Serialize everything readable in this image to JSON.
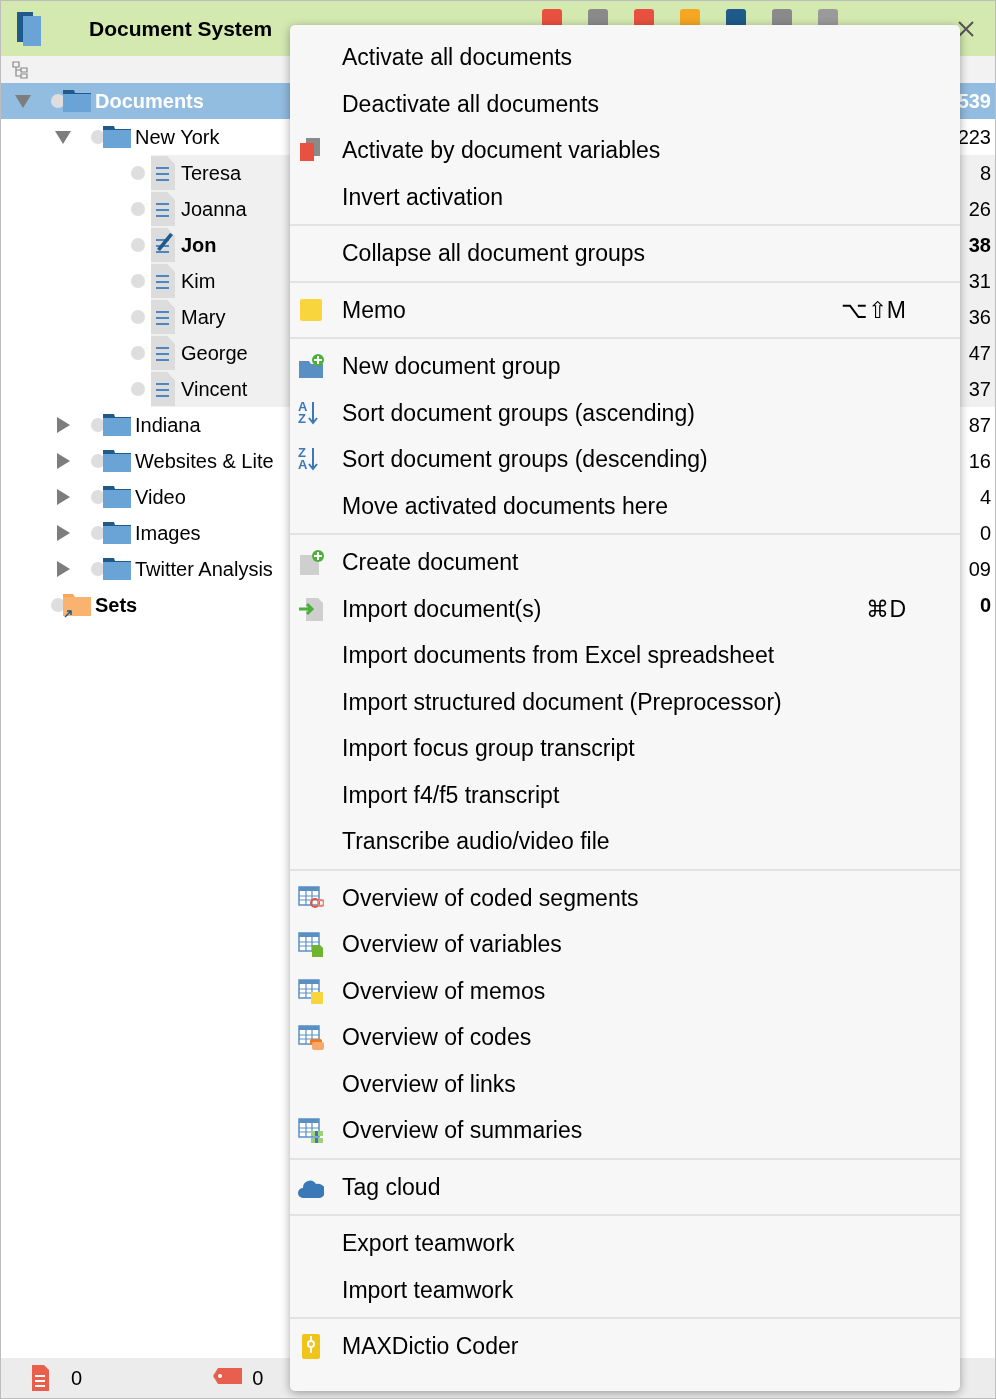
{
  "window": {
    "title": "Document System"
  },
  "tree": [
    {
      "label": "Documents",
      "kind": "root",
      "count": "539",
      "selected": true,
      "expanded": true,
      "children": [
        {
          "label": "New York",
          "kind": "folder",
          "count": "223",
          "selected": false,
          "expanded": true,
          "children": [
            {
              "label": "Teresa",
              "kind": "document",
              "count": "8",
              "selected": false,
              "editing": false
            },
            {
              "label": "Joanna",
              "kind": "document",
              "count": "26",
              "selected": false,
              "editing": false
            },
            {
              "label": "Jon",
              "kind": "document",
              "count": "38",
              "selected": false,
              "editing": true
            },
            {
              "label": "Kim",
              "kind": "document",
              "count": "31",
              "selected": false,
              "editing": false
            },
            {
              "label": "Mary",
              "kind": "document",
              "count": "36",
              "selected": false,
              "editing": false
            },
            {
              "label": "George",
              "kind": "document",
              "count": "47",
              "selected": false,
              "editing": false
            },
            {
              "label": "Vincent",
              "kind": "document",
              "count": "37",
              "selected": false,
              "editing": false
            }
          ]
        },
        {
          "label": "Indiana",
          "kind": "folder",
          "count": "87",
          "selected": false,
          "expanded": false
        },
        {
          "label": "Websites & Lite",
          "kind": "folder",
          "count": "16",
          "selected": false,
          "expanded": false
        },
        {
          "label": "Video",
          "kind": "folder",
          "count": "4",
          "selected": false,
          "expanded": false
        },
        {
          "label": "Images",
          "kind": "folder",
          "count": "0",
          "selected": false,
          "expanded": false
        },
        {
          "label": "Twitter Analysis",
          "kind": "folder",
          "count": "09",
          "selected": false,
          "expanded": false
        }
      ]
    },
    {
      "label": "Sets",
      "kind": "sets",
      "count": "0",
      "selected": false
    }
  ],
  "context_menu": {
    "sections": [
      [
        {
          "label": "Activate all documents"
        },
        {
          "label": "Deactivate all documents"
        },
        {
          "label": "Activate by document variables",
          "kind": "stack"
        },
        {
          "label": "Invert activation"
        }
      ],
      [
        {
          "label": "Collapse all document groups"
        }
      ],
      [
        {
          "label": "Memo",
          "kind": "memo",
          "shortcut": "⌥⇧M"
        }
      ],
      [
        {
          "label": "New document group",
          "kind": "folder"
        },
        {
          "label": "Sort document groups (ascending)",
          "kind": "sort",
          "letters": [
            "A",
            "Z"
          ]
        },
        {
          "label": "Sort document groups (descending)",
          "kind": "sort",
          "letters": [
            "Z",
            "A"
          ]
        },
        {
          "label": "Move activated documents here"
        }
      ],
      [
        {
          "label": "Create document",
          "kind": "create"
        },
        {
          "label": "Import document(s)",
          "kind": "import",
          "shortcut": "⌘D"
        },
        {
          "label": "Import documents from Excel spreadsheet"
        },
        {
          "label": "Import structured document (Preprocessor)"
        },
        {
          "label": "Import focus group transcript"
        },
        {
          "label": "Import f4/f5 transcript"
        },
        {
          "label": "Transcribe audio/video file"
        }
      ],
      [
        {
          "label": "Overview of coded segments",
          "kind": "segments"
        },
        {
          "label": "Overview of variables",
          "kind": "variables"
        },
        {
          "label": "Overview of memos",
          "kind": "memos"
        },
        {
          "label": "Overview of codes",
          "kind": "codes"
        },
        {
          "label": "Overview of links"
        },
        {
          "label": "Overview of summaries",
          "kind": "summaries"
        }
      ],
      [
        {
          "label": "Tag cloud",
          "kind": "cloud"
        }
      ],
      [
        {
          "label": "Export teamwork"
        },
        {
          "label": "Import teamwork"
        }
      ],
      [
        {
          "label": "MAXDictio Coder",
          "kind": "dictionary"
        }
      ]
    ]
  },
  "status_bar": [
    {
      "kind": "documents",
      "value": "0"
    },
    {
      "kind": "codes",
      "value": "0"
    }
  ]
}
